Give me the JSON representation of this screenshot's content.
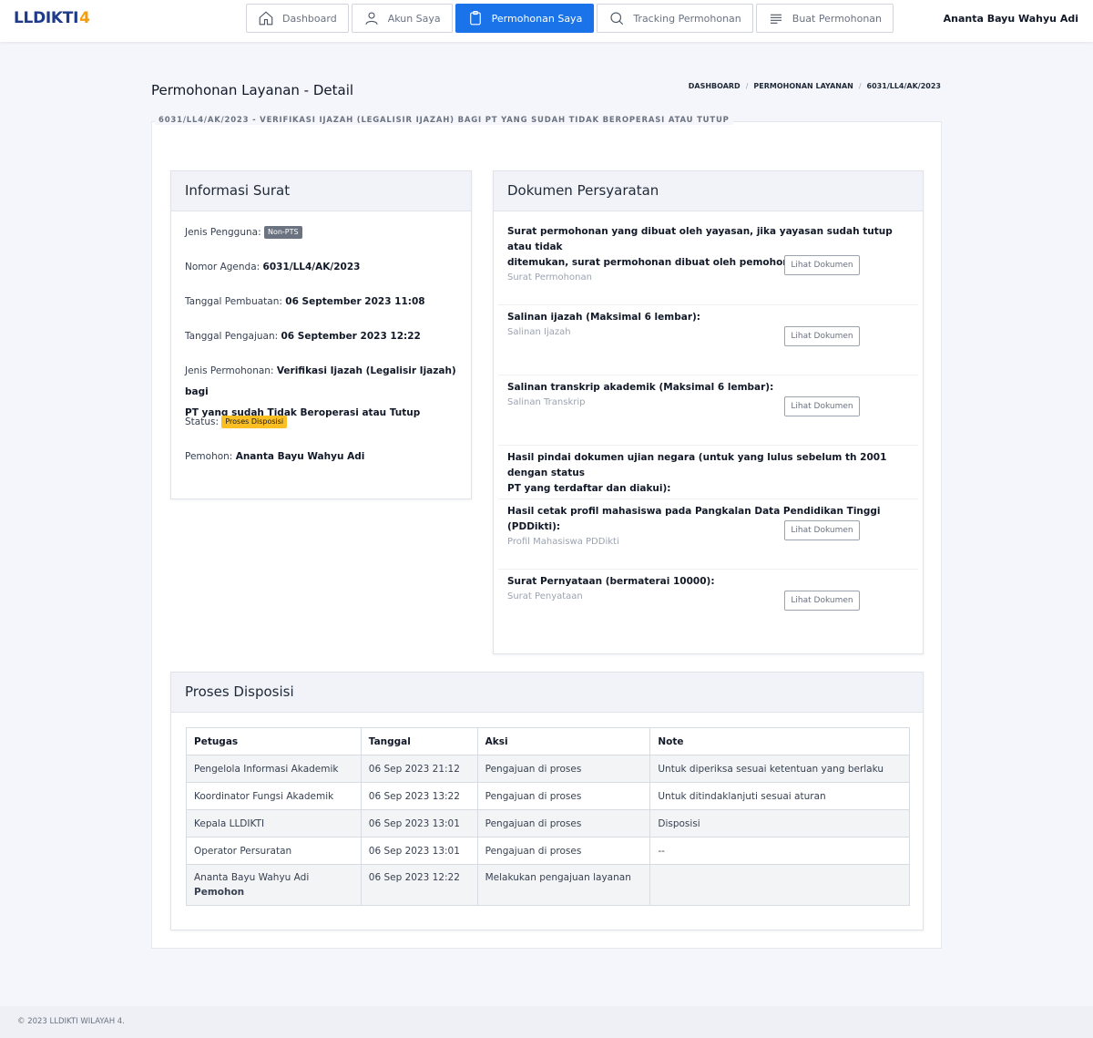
{
  "brand": {
    "logo_text": "LLDIKTI",
    "logo_num": "4"
  },
  "nav": [
    {
      "label": "Dashboard",
      "icon": "home-icon"
    },
    {
      "label": "Akun Saya",
      "icon": "user-icon"
    },
    {
      "label": "Permohonan Saya",
      "icon": "clipboard-icon",
      "active": true
    },
    {
      "label": "Tracking Permohonan",
      "icon": "search-icon"
    },
    {
      "label": "Buat Permohonan",
      "icon": "menu-lines-icon"
    }
  ],
  "user": {
    "name": "Ananta Bayu Wahyu Adi"
  },
  "page": {
    "title": "Permohonan Layanan - Detail",
    "breadcrumb": [
      "DASHBOARD",
      "PERMOHONAN LAYANAN",
      "6031/LL4/AK/2023"
    ],
    "legend": "6031/LL4/AK/2023 - VERIFIKASI IJAZAH (LEGALISIR IJAZAH) BAGI PT YANG SUDAH TIDAK BEROPERASI ATAU TUTUP"
  },
  "info": {
    "title": "Informasi Surat",
    "jenis_pengguna_label": "Jenis Pengguna:",
    "jenis_pengguna_value": "Non-PTS",
    "nomor_agenda_label": "Nomor Agenda:",
    "nomor_agenda_value": "6031/LL4/AK/2023",
    "tanggal_pembuatan_label": "Tanggal Pembuatan:",
    "tanggal_pembuatan_value": "06 September 2023 11:08",
    "tanggal_pengajuan_label": "Tanggal Pengajuan:",
    "tanggal_pengajuan_value": "06 September 2023 12:22",
    "jenis_permohonan_label": "Jenis Permohonan:",
    "jenis_permohonan_value_1": "Verifikasi Ijazah (Legalisir Ijazah) bagi",
    "jenis_permohonan_value_2": "PT yang sudah Tidak Beroperasi atau Tutup",
    "status_label": "Status:",
    "status_value": "Proses Disposisi",
    "pemohon_label": "Pemohon:",
    "pemohon_value": "Ananta Bayu Wahyu Adi"
  },
  "dokumen": {
    "title": "Dokumen Persyaratan",
    "button_label": "Lihat Dokumen",
    "items": [
      {
        "title_1": "Surat permohonan yang dibuat oleh yayasan, jika yayasan sudah tutup atau tidak",
        "title_2": "ditemukan, surat permohonan dibuat oleh pemohon:",
        "sub": "Surat Permohonan"
      },
      {
        "title_1": "Salinan ijazah (Maksimal 6 lembar):",
        "sub": "Salinan Ijazah"
      },
      {
        "title_1": "Salinan transkrip akademik (Maksimal 6 lembar):",
        "sub": "Salinan Transkrip"
      },
      {
        "title_1": "Hasil pindai dokumen ujian negara (untuk yang lulus sebelum th 2001 dengan status",
        "title_2": "PT yang terdaftar dan diakui):"
      },
      {
        "title_1": "Hasil cetak profil mahasiswa pada Pangkalan Data Pendidikan Tinggi (PDDikti):",
        "sub": "Profil Mahasiswa PDDikti"
      },
      {
        "title_1": "Surat Pernyataan (bermaterai 10000):",
        "sub": "Surat Penyataan"
      }
    ]
  },
  "disposisi": {
    "title": "Proses Disposisi",
    "columns": [
      "Petugas",
      "Tanggal",
      "Aksi",
      "Note"
    ],
    "rows": [
      {
        "petugas": "Pengelola Informasi Akademik",
        "tanggal": "06 Sep 2023 21:12",
        "aksi": "Pengajuan di proses",
        "note": "Untuk diperiksa sesuai ketentuan yang berlaku"
      },
      {
        "petugas": "Koordinator Fungsi Akademik",
        "tanggal": "06 Sep 2023 13:22",
        "aksi": "Pengajuan di proses",
        "note": "Untuk ditindaklanjuti sesuai aturan"
      },
      {
        "petugas": "Kepala LLDIKTI",
        "tanggal": "06 Sep 2023 13:01",
        "aksi": "Pengajuan di proses",
        "note": "Disposisi"
      },
      {
        "petugas": "Operator Persuratan",
        "tanggal": "06 Sep 2023 13:01",
        "aksi": "Pengajuan di proses",
        "note": "--"
      },
      {
        "petugas": "Ananta Bayu Wahyu Adi",
        "petugas_role": "Pemohon",
        "tanggal": "06 Sep 2023 12:22",
        "aksi": "Melakukan pengajuan layanan",
        "note": ""
      }
    ]
  },
  "footer": {
    "text": "© 2023 LLDIKTI WILAYAH 4."
  },
  "colors": {
    "primary": "#1a73e8",
    "brand": "#1e3a8a",
    "accent": "#f59e0b",
    "status_badge": "#fbbf24",
    "user_badge": "#6b7280"
  }
}
